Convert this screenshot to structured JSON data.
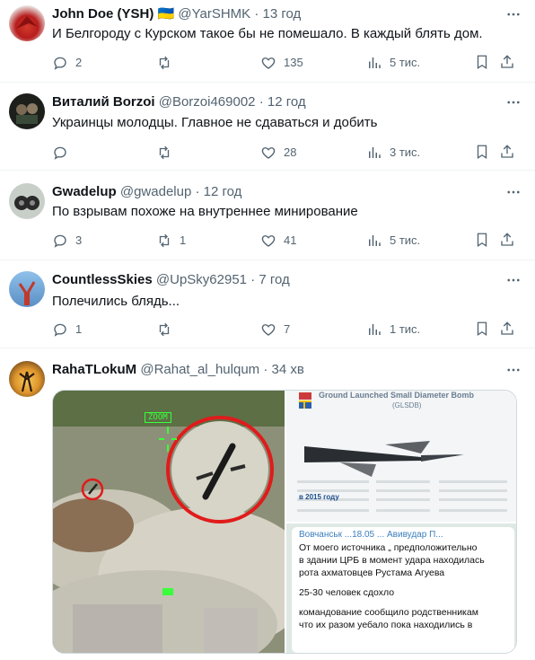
{
  "tweets": [
    {
      "name": "John Doe (YSH)",
      "badge": "🇺🇦",
      "handle": "@YarSHMK",
      "time": "· 13 год",
      "text": "И Белгороду с Курском такое бы не помешало. В каждый блять дом.",
      "replies": "2",
      "retweets": "",
      "likes": "135",
      "views": "5 тис."
    },
    {
      "name": "Виталий Borzoi",
      "badge": "",
      "handle": "@Borzoi469002",
      "time": "· 12 год",
      "text": "Украинцы молодцы. Главное не сдаваться и добить",
      "replies": "",
      "retweets": "",
      "likes": "28",
      "views": "3 тис."
    },
    {
      "name": "Gwadelup",
      "badge": "",
      "handle": "@gwadelup",
      "time": "· 12 год",
      "text": "По взрывам похоже на внутреннее минирование",
      "replies": "3",
      "retweets": "1",
      "likes": "41",
      "views": "5 тис."
    },
    {
      "name": "CountlessSkies",
      "badge": "",
      "handle": "@UpSky62951",
      "time": "· 7 год",
      "text": "Полечились блядь...",
      "replies": "1",
      "retweets": "",
      "likes": "7",
      "views": "1 тис."
    },
    {
      "name": "RahaTLokuM",
      "badge": "",
      "handle": "@Rahat_al_hulqum",
      "time": "· 34 хв",
      "text": ""
    }
  ],
  "media": {
    "video_overlay": "ZOOM",
    "infographic_title": "Ground Launched Small Diameter Bomb",
    "infographic_subtitle": "(GLSDB)",
    "infographic_year": "в 2015 году",
    "chat_header": "Вовчанськ ...18.05 ... Авивудар П...",
    "chat_lines": [
      "От моего источника „ предположительно",
      "в здании ЦРБ в момент удара находилась",
      "рота ахматовцев Рустама Агуева",
      "",
      "25-30 человек сдохло",
      "",
      "командование сообщило родственникам",
      "что их разом уебало пока находились в"
    ]
  },
  "colors": {
    "text": "#0f1419",
    "secondary": "#536471",
    "divider": "#eff3f4"
  }
}
